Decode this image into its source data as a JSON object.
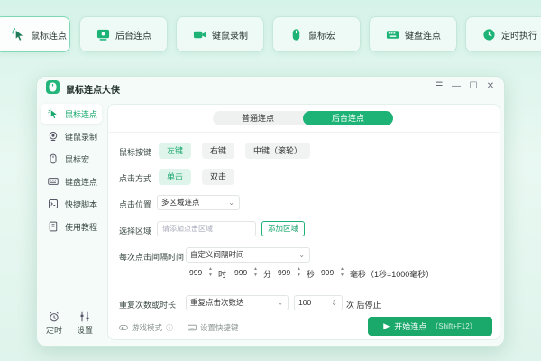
{
  "top_tabs": [
    {
      "label": "鼠标连点",
      "icon": "cursor-click-icon"
    },
    {
      "label": "后台连点",
      "icon": "monitor-icon"
    },
    {
      "label": "键鼠录制",
      "icon": "video-camera-icon"
    },
    {
      "label": "鼠标宏",
      "icon": "mouse-icon"
    },
    {
      "label": "键盘连点",
      "icon": "keyboard-icon"
    },
    {
      "label": "定时执行",
      "icon": "clock-icon"
    }
  ],
  "window": {
    "title": "鼠标连点大侠",
    "controls": {
      "menu": "☰",
      "minimize": "—",
      "maximize": "☐",
      "close": "✕"
    }
  },
  "sidebar": {
    "items": [
      {
        "label": "鼠标连点",
        "icon": "cursor-click-icon"
      },
      {
        "label": "键鼠录制",
        "icon": "record-icon"
      },
      {
        "label": "鼠标宏",
        "icon": "mouse-icon"
      },
      {
        "label": "键盘连点",
        "icon": "keyboard-icon"
      },
      {
        "label": "快捷脚本",
        "icon": "script-icon"
      },
      {
        "label": "使用教程",
        "icon": "book-icon"
      }
    ],
    "timer_label": "定时",
    "settings_label": "设置"
  },
  "mode_tabs": [
    "普通连点",
    "后台连点"
  ],
  "form": {
    "mouse_button": {
      "label": "鼠标按键",
      "options": [
        "左键",
        "右键",
        "中键（滚轮）"
      ]
    },
    "click_mode": {
      "label": "点击方式",
      "options": [
        "单击",
        "双击"
      ]
    },
    "click_position": {
      "label": "点击位置",
      "value": "多区域连点"
    },
    "select_area": {
      "label": "选择区域",
      "placeholder": "请添加点击区域",
      "add_button": "添加区域"
    },
    "interval": {
      "label": "每次点击间隔时间",
      "mode_value": "自定义间隔时间",
      "hours": "999",
      "hours_unit": "时",
      "minutes": "999",
      "minutes_unit": "分",
      "seconds": "999",
      "seconds_unit": "秒",
      "ms": "999",
      "ms_unit": "毫秒（1秒=1000毫秒）"
    },
    "repeat": {
      "label": "重复次数或时长",
      "mode_value": "重复点击次数达",
      "count": "100",
      "suffix": "次 后停止"
    }
  },
  "footer": {
    "game_mode": "游戏模式",
    "hotkey_setting": "设置快捷键",
    "start_button": "开始连点",
    "start_hotkey": "（Shift+F12）"
  },
  "colors": {
    "accent": "#1db376",
    "accent_dark": "#1aa86b",
    "background": "#e3f6ef"
  }
}
